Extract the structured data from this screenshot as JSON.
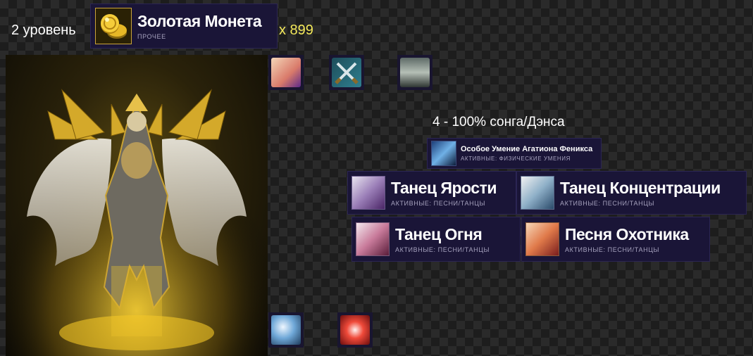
{
  "level_text": "2 уровень",
  "item": {
    "name": "Золотая Монета",
    "category": "ПРОЧЕЕ",
    "quantity": "x 899",
    "icon": "gold-coin-icon"
  },
  "top_icons": [
    "cat-agathion-icon",
    "crossed-swords-icon",
    "armored-knight-icon"
  ],
  "bottom_icons": [
    "wind-spiral-icon",
    "red-burst-icon"
  ],
  "section_heading": "4 - 100% сонга/Дэнса",
  "special_skill": {
    "name": "Особое Умение Агатиона Феникса",
    "category": "АКТИВНЫЕ: ФИЗИЧЕСКИЕ УМЕНИЯ",
    "icon": "phoenix-skill-icon"
  },
  "skills": [
    {
      "name": "Танец Ярости",
      "category": "АКТИВНЫЕ: ПЕСНИ/ТАНЦЫ",
      "icon": "dancer-fury-icon"
    },
    {
      "name": "Танец Концентрации",
      "category": "АКТИВНЫЕ: ПЕСНИ/ТАНЦЫ",
      "icon": "dancer-concentration-icon"
    },
    {
      "name": "Танец Огня",
      "category": "АКТИВНЫЕ: ПЕСНИ/ТАНЦЫ",
      "icon": "dancer-fire-icon"
    },
    {
      "name": "Песня Охотника",
      "category": "АКТИВНЫЕ: ПЕСНИ/ТАНЦЫ",
      "icon": "singer-hunter-icon"
    }
  ]
}
